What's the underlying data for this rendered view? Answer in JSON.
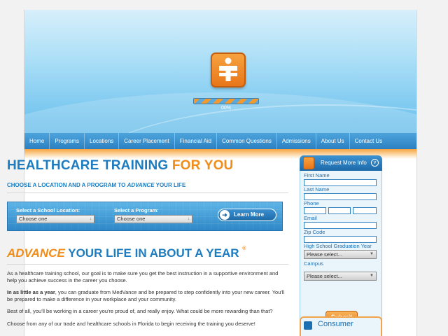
{
  "colors": {
    "accent_blue": "#1d7bbf",
    "accent_orange": "#ef8c1a",
    "nav_blue": "#2c80c0"
  },
  "hero": {
    "loading_percent": 0,
    "loading_text": "00%"
  },
  "nav": {
    "items": [
      "Home",
      "Programs",
      "Locations",
      "Career Placement",
      "Financial Aid",
      "Common Questions",
      "Admissions",
      "About Us",
      "Contact Us"
    ]
  },
  "main": {
    "headline_part1": "HEALTHCARE TRAINING ",
    "headline_part2": "FOR YOU",
    "subhead_part1": "CHOOSE A LOCATION AND A PROGRAM TO ",
    "subhead_part2": "ADVANCE",
    "subhead_part3": " YOUR LIFE",
    "finder": {
      "school_label": "Select a School Location:",
      "school_value": "Choose one",
      "program_label": "Select a Program:",
      "program_value": "Choose one",
      "learn_more": "Learn More"
    },
    "headline2_part1": "ADVANCE",
    "headline2_part2": " YOUR LIFE IN ABOUT A YEAR",
    "headline2_mark": "®",
    "para1": "As a healthcare training school, our goal is to make sure you get the best instruction in a supportive environment and help you achieve success in the career you choose.",
    "para2_bold": "In as little as a year",
    "para2_rest": ", you can graduate from MedVance and be prepared to step confidently into your new career. You'll be prepared to make a difference in your workplace and your community.",
    "para3": "Best of all, you'll be working in a career you're proud of, and really enjoy. What could be more rewarding than that?",
    "para4": "Choose from any of our trade and healthcare schools in Florida to begin receiving the training you deserve!"
  },
  "sidebar": {
    "title": "Request More Info",
    "first_name": "First Name",
    "last_name": "Last Name",
    "phone": "Phone",
    "email": "Email",
    "zip": "Zip Code",
    "grad_year": "High School Graduation Year",
    "grad_year_value": "Please select...",
    "campus": "Campus",
    "campus_value": "Please select...",
    "submit": "Submit",
    "consumer": "Consumer"
  }
}
